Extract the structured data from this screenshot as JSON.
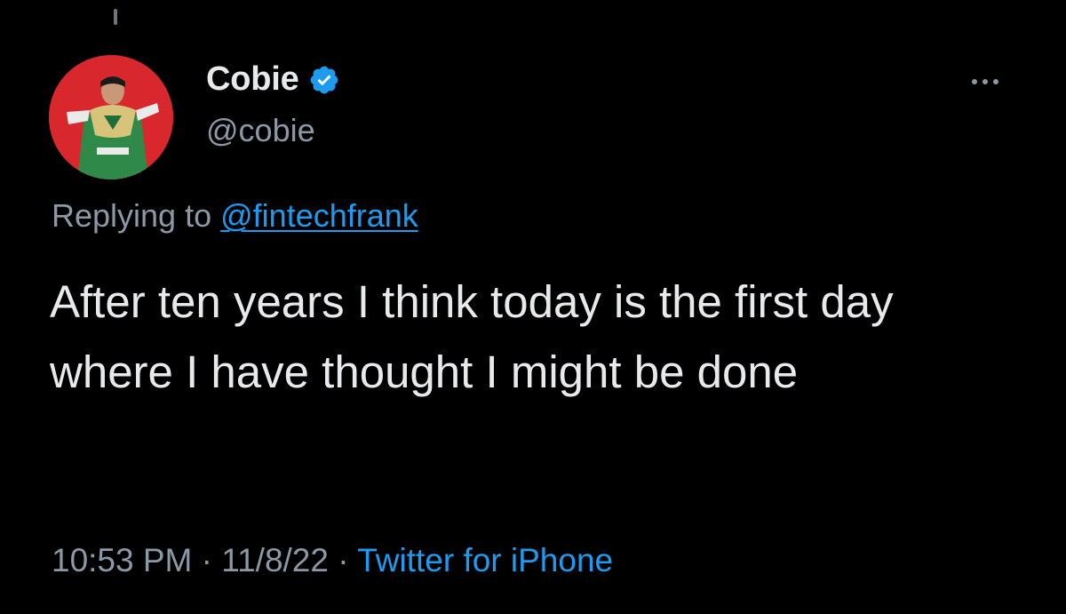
{
  "tweet": {
    "author": {
      "display_name": "Cobie",
      "handle": "@cobie",
      "verified": true,
      "avatar_icon": "avatar-green-ranger"
    },
    "replying_prefix": "Replying to",
    "replying_to": "@fintechfrank",
    "text": "After ten years I think today is the first day where I have thought I might be done",
    "time": "10:53 PM",
    "date": "11/8/22",
    "separator": "·",
    "source": "Twitter for iPhone"
  },
  "icons": {
    "verified": "verified-badge-icon",
    "more": "more-options-icon"
  },
  "colors": {
    "background": "#000000",
    "primary_text": "#e7e9ea",
    "secondary_text": "#8b98a5",
    "accent": "#1d9bf0",
    "avatar_bg": "#d9282d"
  }
}
